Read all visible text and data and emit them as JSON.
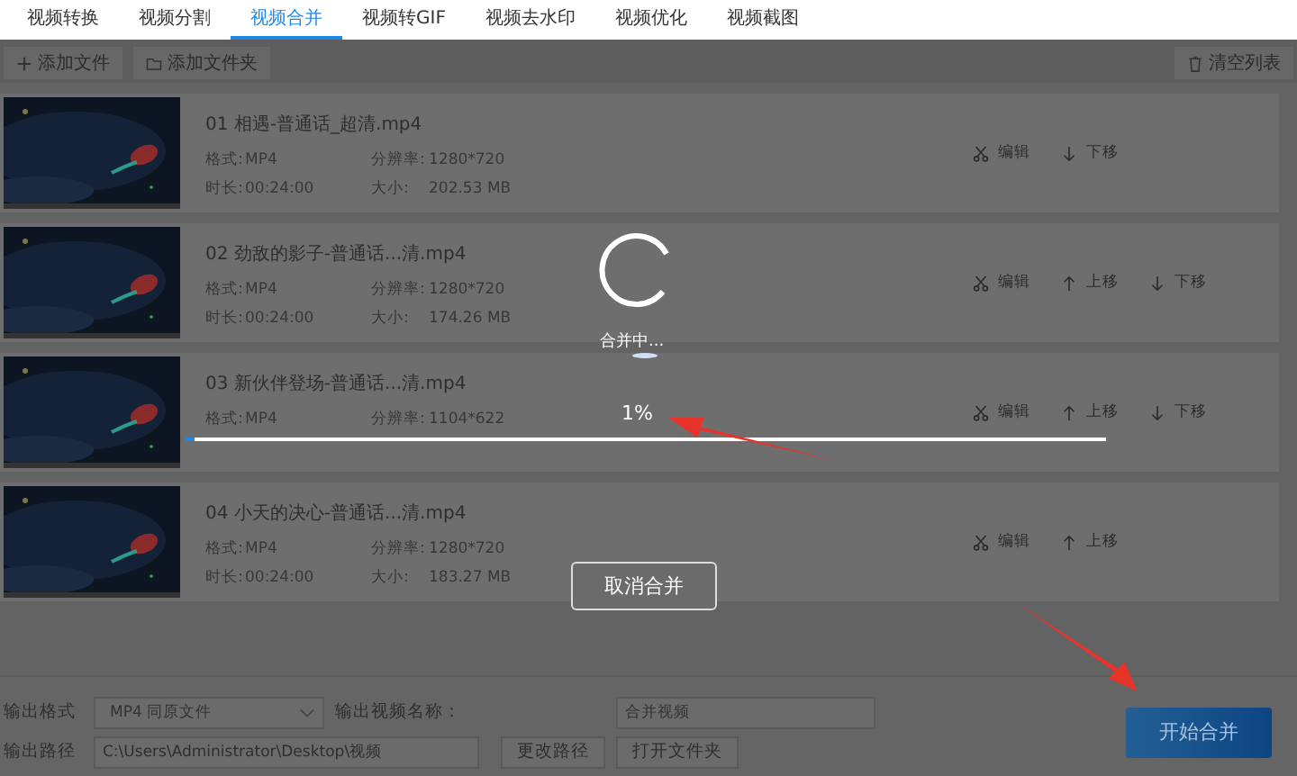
{
  "tabs": [
    {
      "label": "视频转换",
      "selected": false
    },
    {
      "label": "视频分割",
      "selected": false
    },
    {
      "label": "视频合并",
      "selected": true
    },
    {
      "label": "视频转GIF",
      "selected": false
    },
    {
      "label": "视频去水印",
      "selected": false
    },
    {
      "label": "视频优化",
      "selected": false
    },
    {
      "label": "视频截图",
      "selected": false
    }
  ],
  "toolbar": {
    "add_file": "添加文件",
    "add_folder": "添加文件夹",
    "clear_list": "清空列表"
  },
  "files": [
    {
      "title": "01 相遇-普通话_超清.mp4",
      "format_label": "格式:",
      "format": "MP4",
      "resolution_label": "分辨率:",
      "resolution": "1280*720",
      "duration_label": "时长:",
      "duration": "00:24:00",
      "size_label": "大小:",
      "size": "202.53 MB",
      "actions": [
        {
          "kind": "edit",
          "label": "编辑"
        },
        {
          "kind": "down",
          "label": "下移"
        }
      ]
    },
    {
      "title": "02 劲敌的影子-普通话...清.mp4",
      "format_label": "格式:",
      "format": "MP4",
      "resolution_label": "分辨率:",
      "resolution": "1280*720",
      "duration_label": "时长:",
      "duration": "00:24:00",
      "size_label": "大小:",
      "size": "174.26 MB",
      "actions": [
        {
          "kind": "edit",
          "label": "编辑"
        },
        {
          "kind": "up",
          "label": "上移"
        },
        {
          "kind": "down",
          "label": "下移"
        }
      ]
    },
    {
      "title": "03 新伙伴登场-普通话...清.mp4",
      "format_label": "格式:",
      "format": "MP4",
      "resolution_label": "分辨率:",
      "resolution": "1104*622",
      "actions": [
        {
          "kind": "edit",
          "label": "编辑"
        },
        {
          "kind": "up",
          "label": "上移"
        },
        {
          "kind": "down",
          "label": "下移"
        }
      ]
    },
    {
      "title": "04 小天的决心-普通话...清.mp4",
      "format_label": "格式:",
      "format": "MP4",
      "resolution_label": "分辨率:",
      "resolution": "1280*720",
      "duration_label": "时长:",
      "duration": "00:24:00",
      "size_label": "大小:",
      "size": "183.27 MB",
      "actions": [
        {
          "kind": "edit",
          "label": "编辑"
        },
        {
          "kind": "up",
          "label": "上移"
        }
      ]
    }
  ],
  "progress": {
    "status": "合并中...",
    "reading": "1%",
    "level": 0.01,
    "cancel": "取消合并"
  },
  "output": {
    "format_label": "输出格式",
    "format_value": "MP4  同原文件",
    "name_label": "输出视频名称：",
    "name_placeholder": "合并视频",
    "path_label": "输出路径",
    "path_value": "C:\\Users\\Administrator\\Desktop\\视频",
    "change_path": "更改路径",
    "open_folder": "打开文件夹",
    "start": "开始合并"
  }
}
